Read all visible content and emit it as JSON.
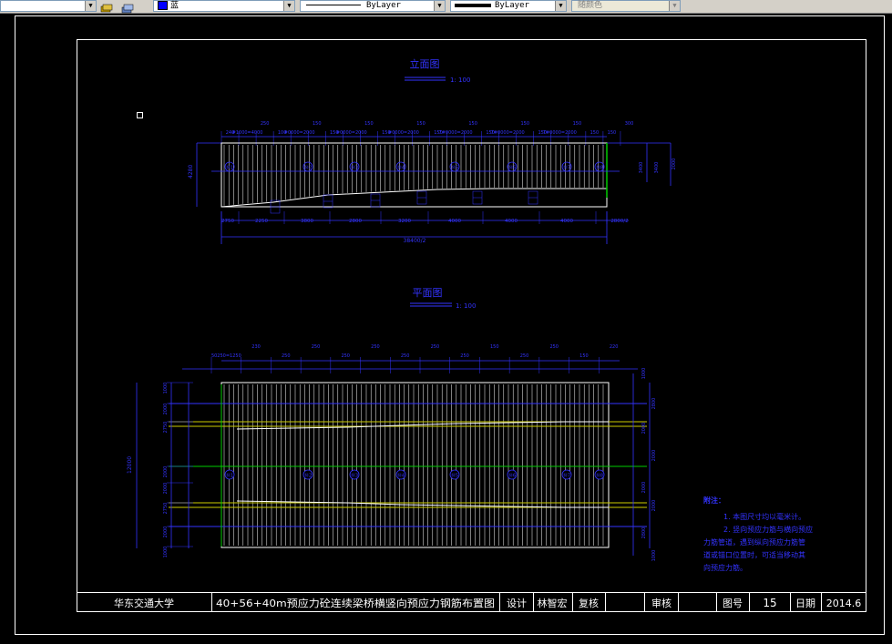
{
  "toolbar": {
    "color_layer": "蓝",
    "linetype": "ByLayer",
    "lineweight": "ByLayer",
    "plotstyle": "随颜色"
  },
  "drawing": {
    "elevation_title": "立面图",
    "elevation_scale": "1: 100",
    "plan_title": "平面图",
    "plan_scale": "1: 100",
    "elev_top_dims": [
      "240",
      "#1000=4000",
      "250",
      "100",
      "#0000=2000",
      "150",
      "150",
      "#0000=2000",
      "150",
      "150",
      "#0000=2000",
      "150",
      "150",
      "7#0000=2000",
      "150",
      "150",
      "7#0000=2000",
      "150",
      "150",
      "7#0000=2000",
      "150",
      "150",
      "150",
      "300"
    ],
    "elev_bottom_dims": [
      "2750",
      "2250",
      "3800",
      "2800",
      "3200",
      "4000",
      "4000",
      "4000",
      "2800/2"
    ],
    "elev_total": "38400/2",
    "elev_left_dim": "4280",
    "elev_right_dims": [
      "3400",
      "3400",
      "2000"
    ],
    "elev_circles": [
      "Ⓝ1",
      "Ⓝ2",
      "Ⓝ3",
      "Ⓝ4",
      "Ⓝ5",
      "Ⓝ6",
      "Ⓝ7",
      "Ⓝ8"
    ],
    "plan_top_dims": [
      "50250=1250",
      "230",
      "250",
      "250",
      "250",
      "250",
      "250",
      "250",
      "250",
      "150",
      "250",
      "250",
      "150",
      "220"
    ],
    "plan_left_dims": [
      "1000",
      "2000",
      "2750",
      "2000",
      "2000",
      "2750",
      "2000",
      "1000"
    ],
    "plan_total_left": "12000",
    "plan_right_dims": [
      "1000",
      "2800",
      "2000",
      "2000",
      "2000",
      "2000",
      "2800",
      "1000"
    ],
    "plan_circles": [
      "Ⓝ1",
      "Ⓝ2",
      "Ⓝ3",
      "Ⓝ4",
      "Ⓝ5",
      "Ⓝ6",
      "Ⓝ7",
      "Ⓝ8"
    ],
    "notes_title": "附注：",
    "notes_lines": [
      "1. 本图尺寸均以毫米计。",
      "2. 竖向预应力筋与横向预应",
      "力筋管道，遇到纵向预应力筋管",
      "道或锚口位置时，可适当移动其",
      "向预应力筋。"
    ]
  },
  "title_block": {
    "school": "华东交通大学",
    "drawing_name": "40+56+40m预应力砼连续梁桥横竖向预应力钢筋布置图",
    "design_label": "设计",
    "designer": "林智宏",
    "review_label": "复核",
    "approve_label": "审核",
    "sheet_label": "图号",
    "sheet_no": "15",
    "date_label": "日期",
    "date": "2014.6"
  },
  "colors": {
    "background": "#000000",
    "frame": "#ffffff",
    "cad_blue": "#3333ff",
    "cad_green": "#00cc00",
    "cad_yellow": "#cccc00"
  }
}
